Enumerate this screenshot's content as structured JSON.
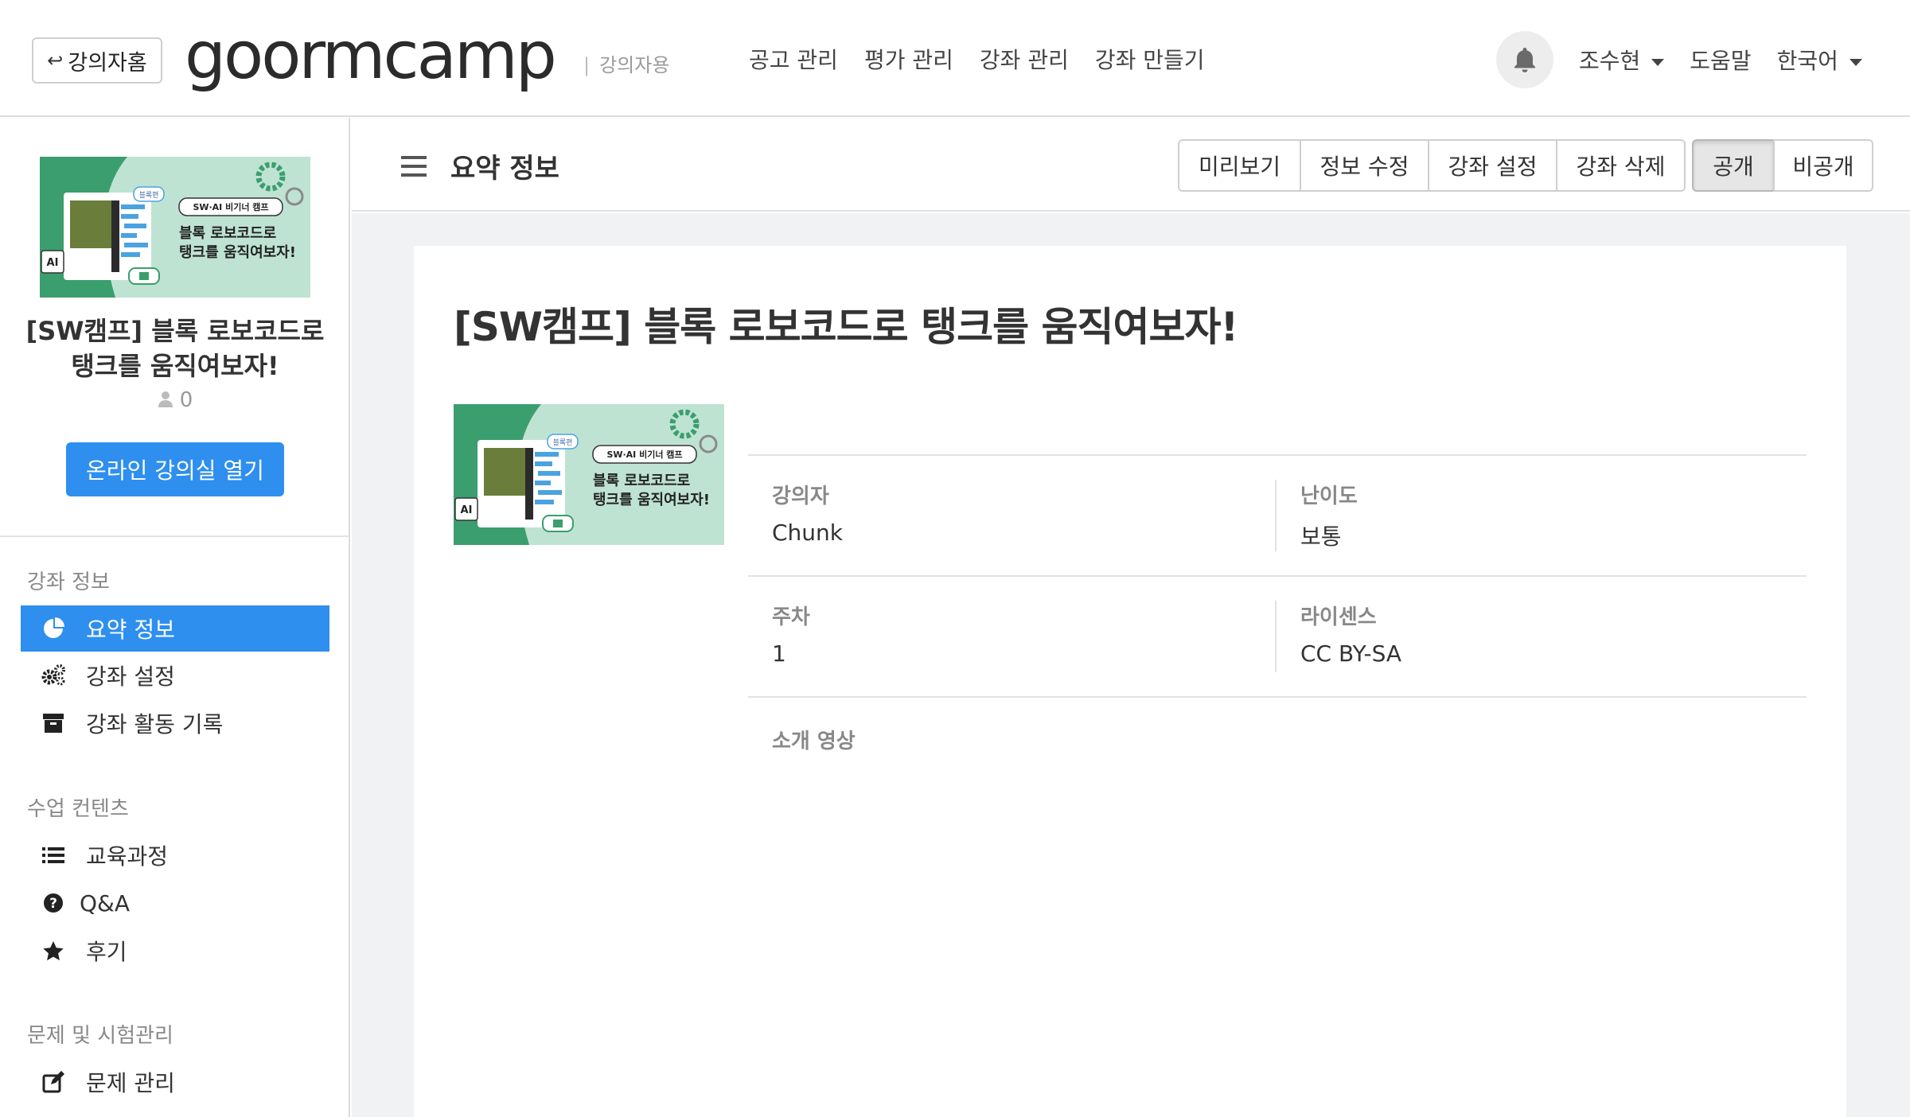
{
  "header": {
    "home_button": "강의자홈",
    "logo_text": "goormcamp",
    "logo_sub": "강의자용",
    "nav": [
      "공고 관리",
      "평가 관리",
      "강좌 관리",
      "강좌 만들기"
    ],
    "user": "조수현",
    "help": "도움말",
    "language": "한국어"
  },
  "thumbnail": {
    "badge_top": "SW·AI 비기너 캠프",
    "badge_tag": "블록편",
    "headline_1": "블록 로보코드로",
    "headline_2": "탱크를 움직여보자!",
    "ai_tag": "AI",
    "colors": {
      "bg": "#bfe3d3",
      "green": "#3b9e6e",
      "blue": "#4aa3e0"
    }
  },
  "sidebar": {
    "course_title": "[SW캠프] 블록 로보코드로 탱크를 움직여보자!",
    "student_count": "0",
    "open_button": "온라인 강의실 열기",
    "sections": [
      {
        "label": "강좌 정보",
        "items": [
          "요약 정보",
          "강좌 설정",
          "강좌 활동 기록"
        ]
      },
      {
        "label": "수업 컨텐츠",
        "items": [
          "교육과정",
          "Q&A",
          "후기"
        ]
      },
      {
        "label": "문제 및 시험관리",
        "items": [
          "문제 관리"
        ]
      }
    ]
  },
  "main": {
    "page_title": "요약 정보",
    "actions": [
      "미리보기",
      "정보 수정",
      "강좌 설정",
      "강좌 삭제"
    ],
    "visibility": [
      "공개",
      "비공개"
    ],
    "course_title": "[SW캠프] 블록 로보코드로 탱크를 움직여보자!",
    "info": {
      "instructor_label": "강의자",
      "instructor_value": "Chunk",
      "difficulty_label": "난이도",
      "difficulty_value": "보통",
      "weeks_label": "주차",
      "weeks_value": "1",
      "license_label": "라이센스",
      "license_value": "CC BY-SA",
      "video_label": "소개 영상"
    }
  },
  "colors": {
    "primary": "#2e8fef",
    "content_bg": "#f1f2f4"
  }
}
